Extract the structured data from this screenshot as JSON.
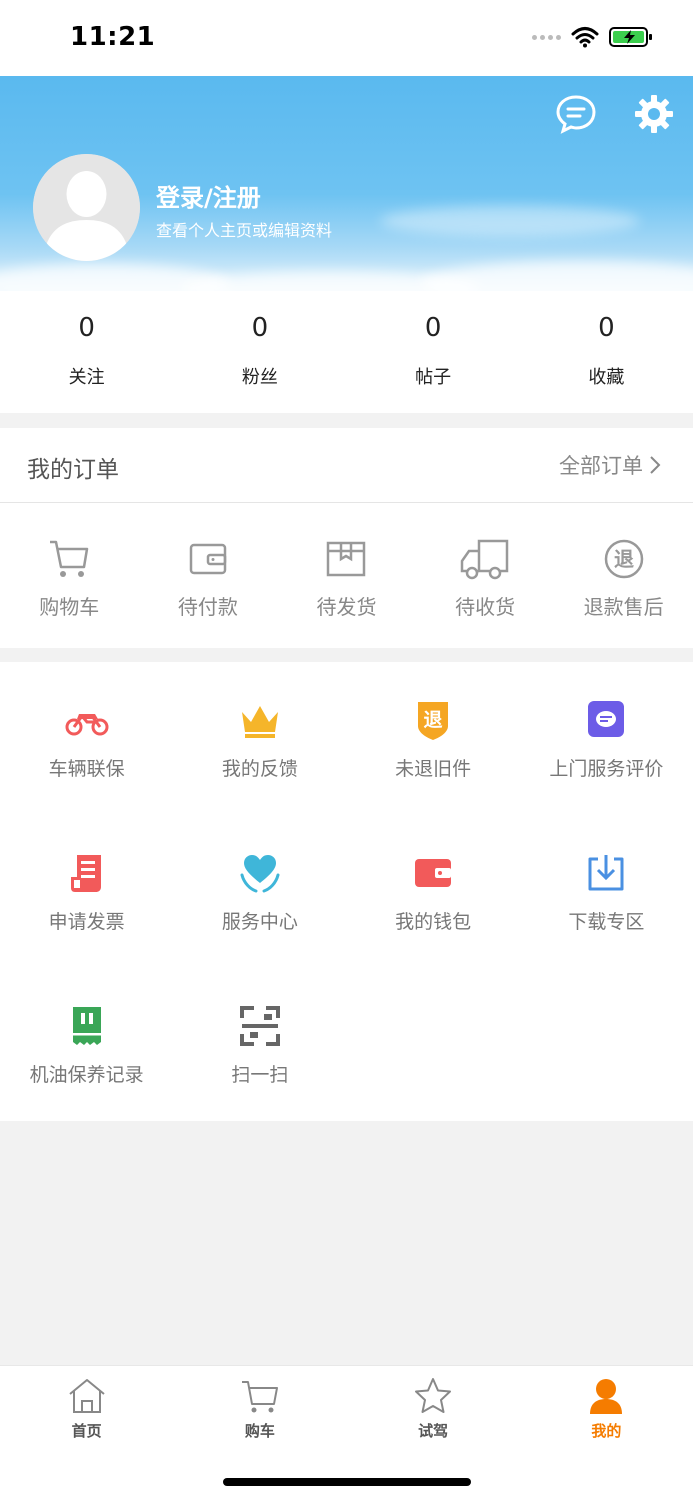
{
  "status_bar": {
    "time": "11:21"
  },
  "header": {
    "login_text": "登录/注册",
    "subtitle": "查看个人主页或编辑资料",
    "icons": [
      "message-icon",
      "settings-icon"
    ]
  },
  "stats": [
    {
      "value": "0",
      "label": "关注"
    },
    {
      "value": "0",
      "label": "粉丝"
    },
    {
      "value": "0",
      "label": "帖子"
    },
    {
      "value": "0",
      "label": "收藏"
    }
  ],
  "orders": {
    "title": "我的订单",
    "all_label": "全部订单",
    "items": [
      {
        "label": "购物车",
        "icon": "cart-icon"
      },
      {
        "label": "待付款",
        "icon": "wallet-icon"
      },
      {
        "label": "待发货",
        "icon": "package-icon"
      },
      {
        "label": "待收货",
        "icon": "truck-icon"
      },
      {
        "label": "退款售后",
        "icon": "refund-icon"
      }
    ]
  },
  "services": [
    {
      "label": "车辆联保",
      "icon": "motorcycle-icon",
      "color": "#f25a5a"
    },
    {
      "label": "我的反馈",
      "icon": "crown-icon",
      "color": "#f5b52a"
    },
    {
      "label": "未退旧件",
      "icon": "return-shield-icon",
      "color": "#f5a623"
    },
    {
      "label": "上门服务评价",
      "icon": "chat-box-icon",
      "color": "#6c5ce7"
    },
    {
      "label": "申请发票",
      "icon": "invoice-icon",
      "color": "#f25a5a"
    },
    {
      "label": "服务中心",
      "icon": "heart-hands-icon",
      "color": "#3fb6d9"
    },
    {
      "label": "我的钱包",
      "icon": "wallet-icon",
      "color": "#f25a5a"
    },
    {
      "label": "下载专区",
      "icon": "download-icon",
      "color": "#4a90e2"
    },
    {
      "label": "机油保养记录",
      "icon": "oil-record-icon",
      "color": "#3aa657"
    },
    {
      "label": "扫一扫",
      "icon": "scan-icon",
      "color": "#666666"
    }
  ],
  "tabbar": {
    "items": [
      {
        "label": "首页",
        "icon": "home-icon"
      },
      {
        "label": "购车",
        "icon": "cart-icon"
      },
      {
        "label": "试驾",
        "icon": "star-icon"
      },
      {
        "label": "我的",
        "icon": "person-icon",
        "active": true
      }
    ],
    "active_color": "#f57c00"
  }
}
